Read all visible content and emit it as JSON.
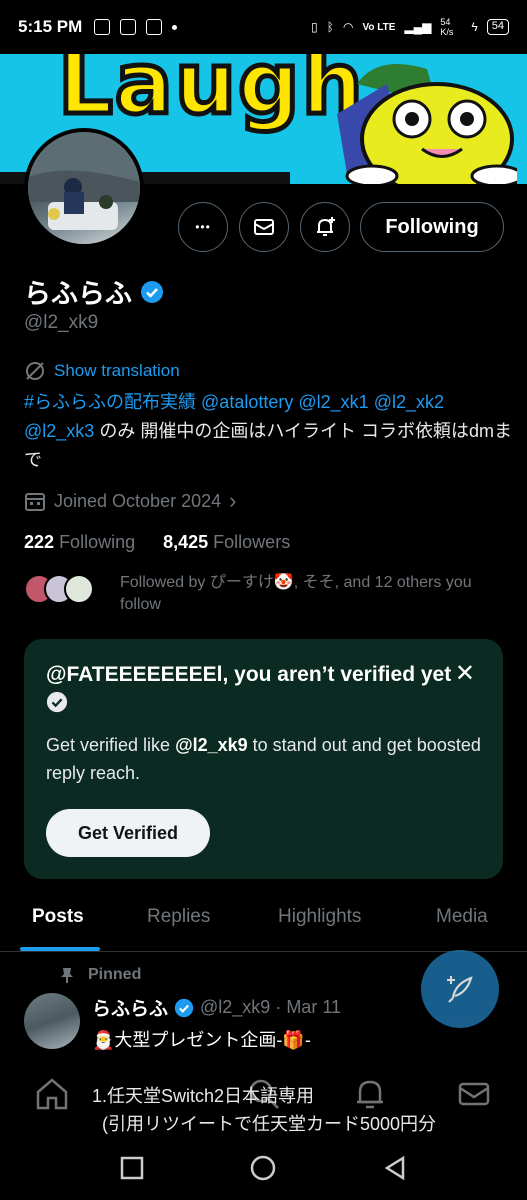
{
  "status_bar": {
    "time": "5:15 PM",
    "network": "Vo LTE",
    "speed": "54 K/s",
    "battery": "54"
  },
  "banner": {
    "text": "Laugh"
  },
  "actions": {
    "more_label": "•••",
    "following_label": "Following"
  },
  "profile": {
    "display_name": "らふらふ",
    "handle": "@l2_xk9",
    "show_translation": "Show translation",
    "bio_link_1": "#らふらふの配布実績",
    "bio_link_2": "@atalottery",
    "bio_link_3": "@l2_xk1",
    "bio_link_4": "@l2_xk2",
    "bio_link_5": "@l2_xk3",
    "bio_rest": " のみ 開催中の企画はハイライト コラボ依頼はdmまで",
    "joined": "Joined October 2024",
    "following_count": "222",
    "following_label": "Following",
    "followers_count": "8,425",
    "followers_label": "Followers",
    "followed_by": "Followed by ぴーすけ🤡, そそ, and 12 others you follow"
  },
  "verify_card": {
    "title": "@FATEEEEEEEEl, you aren’t verified yet",
    "body_prefix": "Get verified like ",
    "body_handle": "@l2_xk9",
    "body_suffix": " to stand out and get boosted reply reach.",
    "button": "Get Verified",
    "close": "✕"
  },
  "tabs": [
    "Posts",
    "Replies",
    "Highlights",
    "Media"
  ],
  "tweet": {
    "pinned_label": "Pinned",
    "name": "らふらふ",
    "meta": "@l2_xk9 · Mar 11",
    "line1": "🎅大型プレゼント企画‐🎁‐",
    "line2": "1.任天堂Switch2日本語専用",
    "line3": "(引用リツイートで任天堂カード5000円分"
  },
  "colors": {
    "accent": "#1d9bf0",
    "card_bg": "#0b2a22",
    "muted": "#71767b"
  }
}
